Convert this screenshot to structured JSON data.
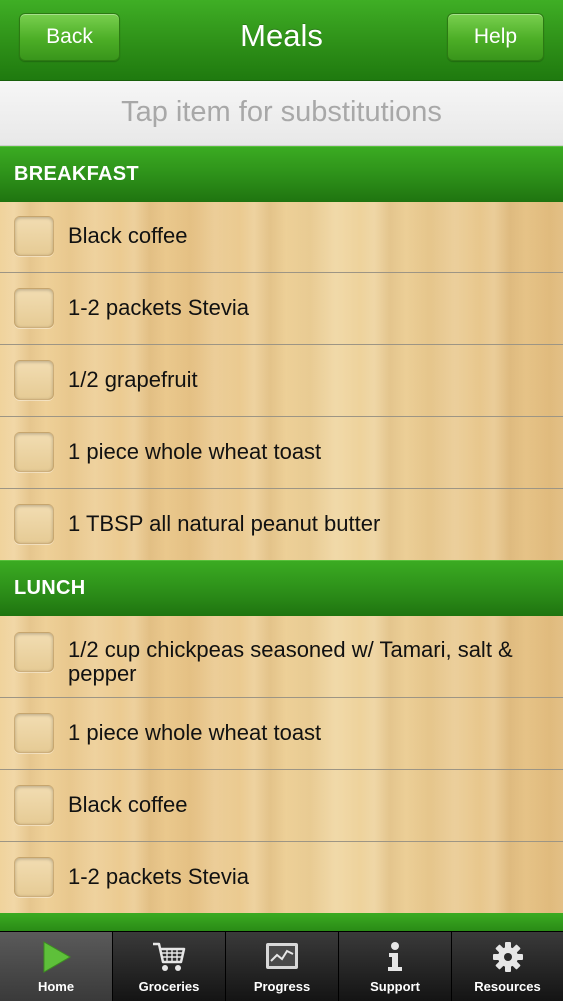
{
  "nav": {
    "back_label": "Back",
    "title": "Meals",
    "help_label": "Help"
  },
  "hint": "Tap item for substitutions",
  "sections": [
    {
      "title": "BREAKFAST",
      "items": [
        "Black coffee",
        "1-2 packets Stevia",
        "1/2 grapefruit",
        "1 piece whole wheat toast",
        "1 TBSP all natural peanut butter"
      ]
    },
    {
      "title": "LUNCH",
      "items": [
        "1/2 cup chickpeas seasoned w/ Tamari, salt & pepper",
        "1 piece whole wheat toast",
        "Black coffee",
        "1-2 packets Stevia"
      ]
    }
  ],
  "tabs": [
    {
      "label": "Home",
      "icon": "play-icon",
      "active": true
    },
    {
      "label": "Groceries",
      "icon": "cart-icon",
      "active": false
    },
    {
      "label": "Progress",
      "icon": "chart-icon",
      "active": false
    },
    {
      "label": "Support",
      "icon": "info-icon",
      "active": false
    },
    {
      "label": "Resources",
      "icon": "gear-icon",
      "active": false
    }
  ]
}
